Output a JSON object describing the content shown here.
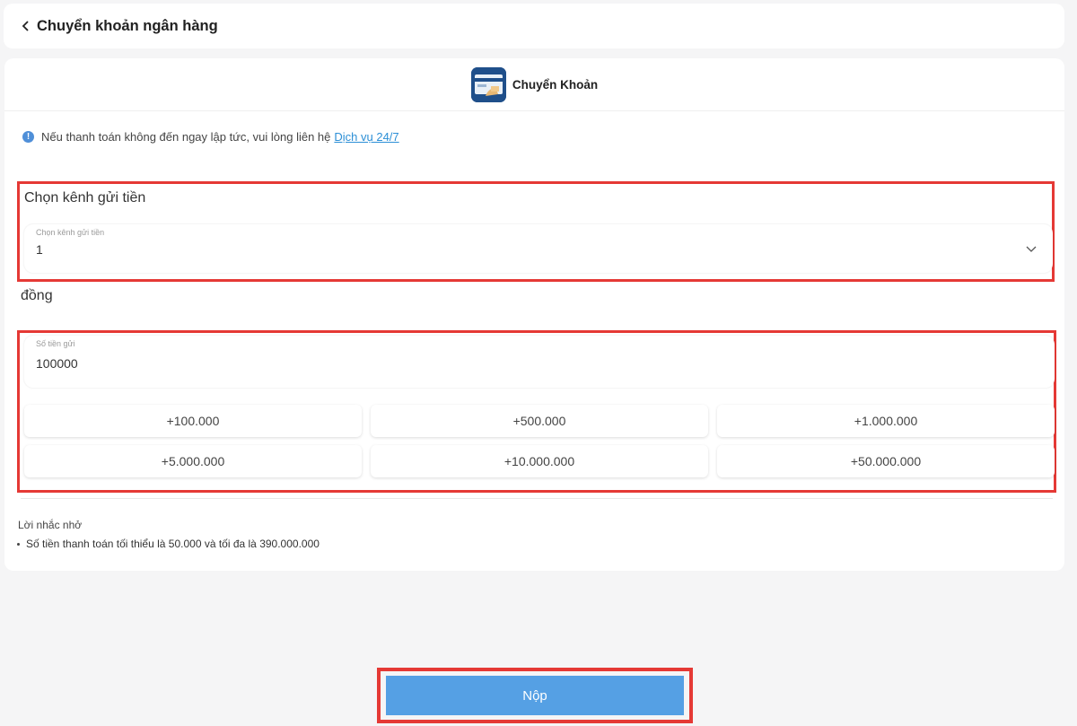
{
  "header": {
    "title": "Chuyển khoản ngân hàng",
    "back_icon": "chevron-left-icon"
  },
  "payment_method": {
    "label": "Chuyển Khoản",
    "icon": "bank-transfer-icon"
  },
  "notice": {
    "text": "Nếu thanh toán không đến ngay lập tức, vui lòng liên hệ",
    "link": "Dịch vụ 24/7",
    "icon": "info-icon"
  },
  "channel": {
    "section_title": "Chọn kênh gửi tiền",
    "field_label": "Chọn kênh gửi tiền",
    "value": "1"
  },
  "amount": {
    "currency_label": "đồng",
    "field_label": "Số tiền gửi",
    "value": "100000",
    "quick_options": [
      "+100.000",
      "+500.000",
      "+1.000.000",
      "+5.000.000",
      "+10.000.000",
      "+50.000.000"
    ]
  },
  "reminder": {
    "title": "Lời nhắc nhở",
    "items": [
      "Số tiền thanh toán tối thiểu là 50.000 và tối đa là 390.000.000"
    ]
  },
  "submit": {
    "label": "Nộp"
  },
  "colors": {
    "accent": "#55a0e4",
    "highlight": "#e53935",
    "link": "#2c8fd6"
  }
}
